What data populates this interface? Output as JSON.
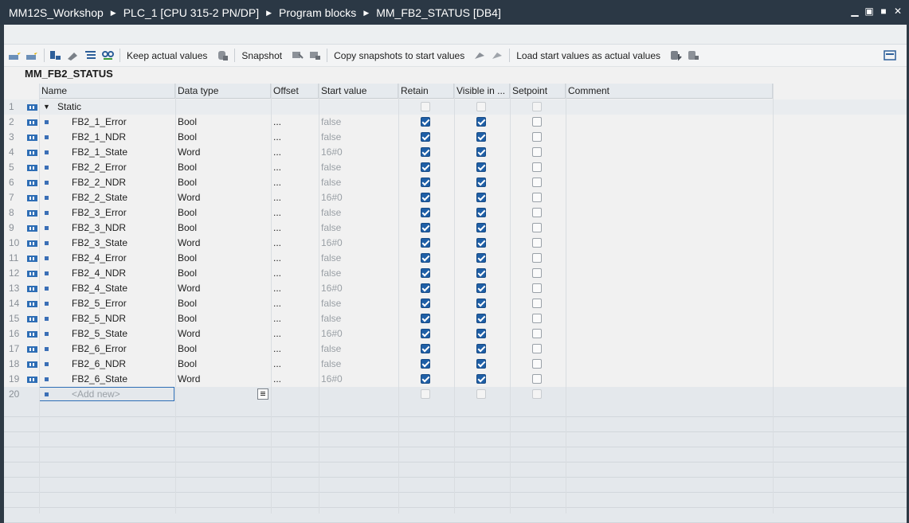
{
  "titlebar": {
    "crumbs": [
      "MM12S_Workshop",
      "PLC_1 [CPU 315-2 PN/DP]",
      "Program blocks",
      "MM_FB2_STATUS [DB4]"
    ],
    "buttons": [
      "minimize-icon",
      "restore-icon",
      "maximize-icon",
      "close-icon"
    ]
  },
  "toolbar": {
    "keep_actual_values": "Keep actual values",
    "snapshot": "Snapshot",
    "copy_snapshots": "Copy snapshots to start values",
    "load_start_values": "Load start values as actual values"
  },
  "block": {
    "title": "MM_FB2_STATUS"
  },
  "table": {
    "columns": [
      "Name",
      "Data type",
      "Offset",
      "Start value",
      "Retain",
      "Visible in ...",
      "Setpoint",
      "Comment"
    ],
    "rows": [
      {
        "num": "1",
        "name": "Static",
        "type": "",
        "offset": "",
        "start": "",
        "retain": "disabled",
        "visible": "disabled",
        "setpoint": "disabled"
      },
      {
        "num": "2",
        "name": "FB2_1_Error",
        "type": "Bool",
        "offset": "...",
        "start": "false",
        "retain": "on",
        "visible": "on",
        "setpoint": "off"
      },
      {
        "num": "3",
        "name": "FB2_1_NDR",
        "type": "Bool",
        "offset": "...",
        "start": "false",
        "retain": "on",
        "visible": "on",
        "setpoint": "off"
      },
      {
        "num": "4",
        "name": "FB2_1_State",
        "type": "Word",
        "offset": "...",
        "start": "16#0",
        "retain": "on",
        "visible": "on",
        "setpoint": "off"
      },
      {
        "num": "5",
        "name": "FB2_2_Error",
        "type": "Bool",
        "offset": "...",
        "start": "false",
        "retain": "on",
        "visible": "on",
        "setpoint": "off"
      },
      {
        "num": "6",
        "name": "FB2_2_NDR",
        "type": "Bool",
        "offset": "...",
        "start": "false",
        "retain": "on",
        "visible": "on",
        "setpoint": "off"
      },
      {
        "num": "7",
        "name": "FB2_2_State",
        "type": "Word",
        "offset": "...",
        "start": "16#0",
        "retain": "on",
        "visible": "on",
        "setpoint": "off"
      },
      {
        "num": "8",
        "name": "FB2_3_Error",
        "type": "Bool",
        "offset": "...",
        "start": "false",
        "retain": "on",
        "visible": "on",
        "setpoint": "off"
      },
      {
        "num": "9",
        "name": "FB2_3_NDR",
        "type": "Bool",
        "offset": "...",
        "start": "false",
        "retain": "on",
        "visible": "on",
        "setpoint": "off"
      },
      {
        "num": "10",
        "name": "FB2_3_State",
        "type": "Word",
        "offset": "...",
        "start": "16#0",
        "retain": "on",
        "visible": "on",
        "setpoint": "off"
      },
      {
        "num": "11",
        "name": "FB2_4_Error",
        "type": "Bool",
        "offset": "...",
        "start": "false",
        "retain": "on",
        "visible": "on",
        "setpoint": "off"
      },
      {
        "num": "12",
        "name": "FB2_4_NDR",
        "type": "Bool",
        "offset": "...",
        "start": "false",
        "retain": "on",
        "visible": "on",
        "setpoint": "off"
      },
      {
        "num": "13",
        "name": "FB2_4_State",
        "type": "Word",
        "offset": "...",
        "start": "16#0",
        "retain": "on",
        "visible": "on",
        "setpoint": "off"
      },
      {
        "num": "14",
        "name": "FB2_5_Error",
        "type": "Bool",
        "offset": "...",
        "start": "false",
        "retain": "on",
        "visible": "on",
        "setpoint": "off"
      },
      {
        "num": "15",
        "name": "FB2_5_NDR",
        "type": "Bool",
        "offset": "...",
        "start": "false",
        "retain": "on",
        "visible": "on",
        "setpoint": "off"
      },
      {
        "num": "16",
        "name": "FB2_5_State",
        "type": "Word",
        "offset": "...",
        "start": "16#0",
        "retain": "on",
        "visible": "on",
        "setpoint": "off"
      },
      {
        "num": "17",
        "name": "FB2_6_Error",
        "type": "Bool",
        "offset": "...",
        "start": "false",
        "retain": "on",
        "visible": "on",
        "setpoint": "off"
      },
      {
        "num": "18",
        "name": "FB2_6_NDR",
        "type": "Bool",
        "offset": "...",
        "start": "false",
        "retain": "on",
        "visible": "on",
        "setpoint": "off"
      },
      {
        "num": "19",
        "name": "FB2_6_State",
        "type": "Word",
        "offset": "...",
        "start": "16#0",
        "retain": "on",
        "visible": "on",
        "setpoint": "off"
      },
      {
        "num": "20",
        "name": "<Add new>",
        "type": "",
        "offset": "",
        "start": "",
        "retain": "disabled",
        "visible": "disabled",
        "setpoint": "disabled"
      }
    ]
  },
  "colors": {
    "titlebar": "#2b3845",
    "checkbox_on": "#1f5fa6",
    "header": "#e6eaee"
  }
}
